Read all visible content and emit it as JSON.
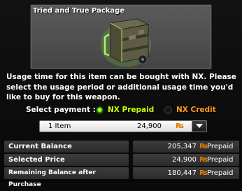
{
  "item": {
    "title": "Tried and True Package",
    "image_icon": "supply-crate-icon"
  },
  "description": "Usage time for this item can be bought with NX.  Please select the usage period or additional usage time you'd like to buy for this weapon.",
  "payment": {
    "label": "Select payment :",
    "options": [
      {
        "label": "NX Prepaid",
        "selected": true,
        "color": "#c8ff00"
      },
      {
        "label": "NX Credit",
        "selected": false,
        "color": "#ff9a14"
      }
    ]
  },
  "purchase_select": {
    "quantity": "1 Item",
    "price": "24,900",
    "currency_symbol": "₨"
  },
  "summary": [
    {
      "label": "Current Balance",
      "value": "205,347",
      "currency_symbol": "₨",
      "kind": "Prepaid"
    },
    {
      "label": "Selected Price",
      "value": "24,900",
      "currency_symbol": "₨",
      "kind": "Prepaid"
    },
    {
      "label": "Remaining Balance after Purchase",
      "value": "180,447",
      "currency_symbol": "₨",
      "kind": "Prepaid"
    }
  ],
  "colors": {
    "accent_currency": "#e07a00",
    "prepaid": "#c8ff00",
    "credit": "#ff9a14"
  }
}
